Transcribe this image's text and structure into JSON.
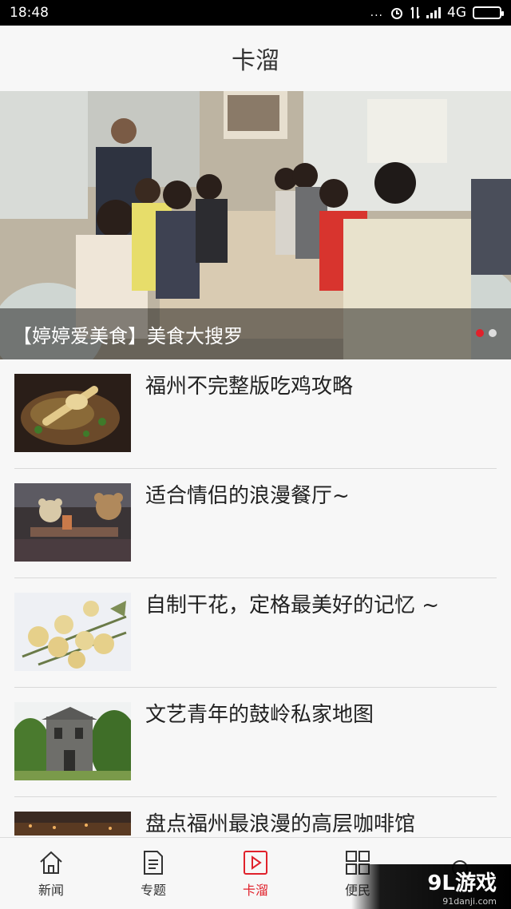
{
  "status_bar": {
    "time": "18:48",
    "dots": "...",
    "network": "4G"
  },
  "header": {
    "title": "卡溜"
  },
  "banner": {
    "caption": "【婷婷爱美食】美食大搜罗",
    "dots": 2,
    "active_dot": 0
  },
  "list": {
    "items": [
      {
        "title": "福州不完整版吃鸡攻略",
        "thumb": "food-dish-image"
      },
      {
        "title": "适合情侣的浪漫餐厅~",
        "thumb": "restaurant-bears-image"
      },
      {
        "title": "自制干花，定格最美好的记忆 ~",
        "thumb": "dried-roses-image"
      },
      {
        "title": "文艺青年的鼓岭私家地图",
        "thumb": "stone-house-image"
      },
      {
        "title": "盘点福州最浪漫的高层咖啡馆",
        "thumb": "night-city-image"
      }
    ]
  },
  "tab_bar": {
    "tabs": [
      {
        "label": "新闻",
        "icon": "home-icon"
      },
      {
        "label": "专题",
        "icon": "document-icon"
      },
      {
        "label": "卡溜",
        "icon": "play-icon"
      },
      {
        "label": "便民",
        "icon": "grid-icon"
      },
      {
        "label": "",
        "icon": "circle-icon"
      }
    ],
    "active_index": 2
  },
  "watermark": {
    "logo": "9L游戏",
    "url": "91danji.com"
  },
  "colors": {
    "accent": "#e0212b",
    "background": "#f7f7f7",
    "text": "#222222"
  }
}
